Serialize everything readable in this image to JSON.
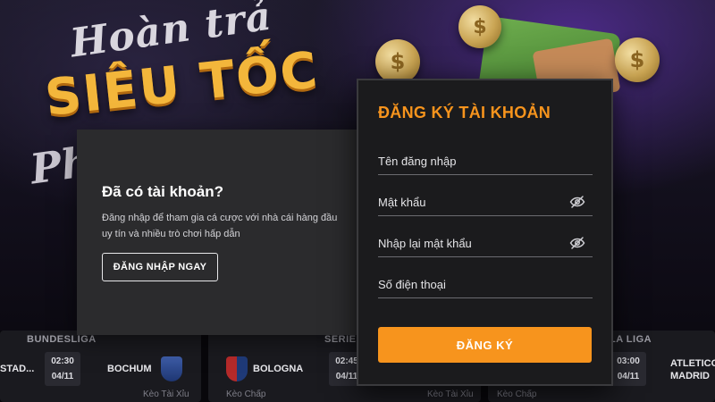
{
  "banner": {
    "script_text": "Hoàn trả",
    "headline": "SIÊU TỐC",
    "subline": "Ph"
  },
  "login_prompt": {
    "title": "Đã có tài khoản?",
    "description": "Đăng nhập để tham gia cá cược với nhà cái hàng đầu uy tín và nhiều trò chơi hấp dẫn",
    "button_label": "ĐĂNG NHẬP NGAY"
  },
  "register": {
    "title": "ĐĂNG KÝ TÀI KHOẢN",
    "fields": [
      {
        "placeholder": "Tên đăng nhập",
        "value": ""
      },
      {
        "placeholder": "Mật khẩu",
        "value": ""
      },
      {
        "placeholder": "Nhập lại mật khẩu",
        "value": ""
      },
      {
        "placeholder": "Số điện thoại",
        "value": ""
      }
    ],
    "submit_label": "ĐĂNG KÝ",
    "accent_color": "#f7941d"
  },
  "matches": [
    {
      "league": "BUNDESLIGA",
      "home": "STAD...",
      "time": "02:30",
      "date": "04/11",
      "away": "BOCHUM",
      "odds_label": "Kèo Tài Xỉu"
    },
    {
      "league": "SERIE",
      "home": "BOLOGNA",
      "time": "02:45",
      "date": "04/11",
      "odds_label_left": "Kèo Chấp",
      "odds_label_right": "Kèo Tài Xỉu"
    },
    {
      "league": "LA LIGA",
      "time": "03:00",
      "date": "04/11",
      "away": "ATLETICO MADRID",
      "odds_label": "Kèo Chấp"
    }
  ]
}
